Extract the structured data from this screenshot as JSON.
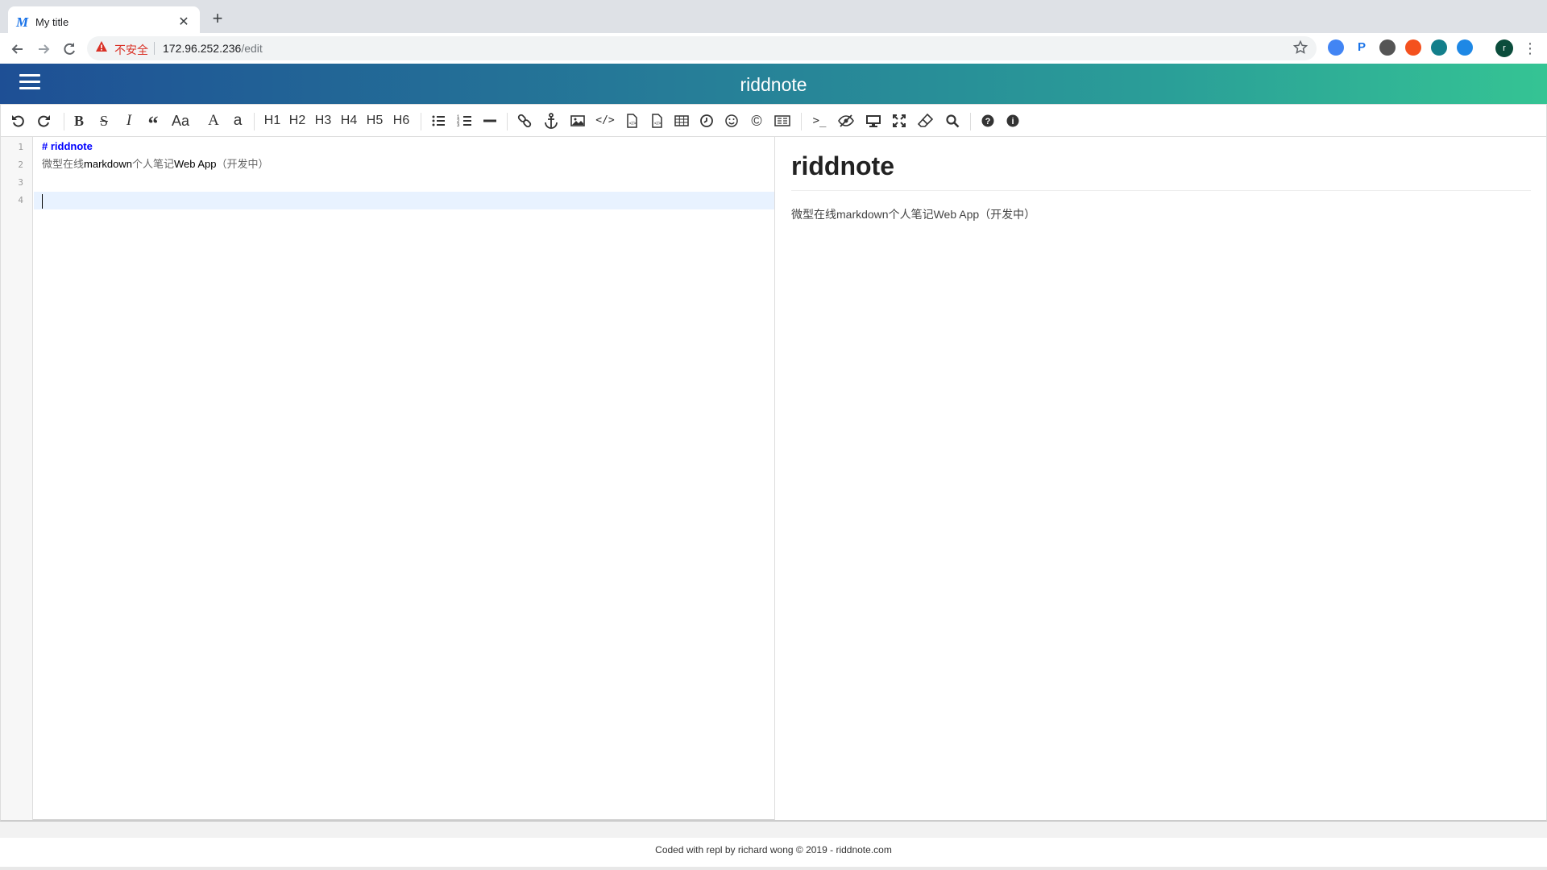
{
  "browser": {
    "tab_title": "My title",
    "tab_favicon": "M",
    "new_tab_symbol": "+",
    "close_symbol": "✕",
    "security_label": "不安全",
    "url_host": "172.96.252.236",
    "url_path": "/edit",
    "profile_initial": "r",
    "extensions": [
      {
        "name": "chrome-ext-icon",
        "glyph": "",
        "color": "#4285f4"
      },
      {
        "name": "p-ext-icon",
        "glyph": "P",
        "color": "#1a73e8"
      },
      {
        "name": "feather-ext-icon",
        "glyph": "",
        "color": "#555555"
      },
      {
        "name": "orange-ext-icon",
        "glyph": "",
        "color": "#f4511e"
      },
      {
        "name": "book-ext-icon",
        "glyph": "",
        "color": "#137f8b"
      },
      {
        "name": "bird-ext-icon",
        "glyph": "",
        "color": "#1e88e5"
      }
    ]
  },
  "app": {
    "title": "riddnote",
    "gradient": [
      "#1e4f95",
      "#35c494"
    ]
  },
  "editor_toolbar": {
    "headings": [
      "H1",
      "H2",
      "H3",
      "H4",
      "H5",
      "H6"
    ],
    "case_upper": "Aa",
    "case_big_a": "A",
    "case_small_a": "a"
  },
  "editor": {
    "line_numbers": [
      "1",
      "2",
      "3",
      "4"
    ],
    "line1": "# riddnote",
    "line2_parts": [
      "微型在线",
      "markdown",
      "个人笔记",
      "Web App",
      "（开发中）"
    ]
  },
  "preview": {
    "heading": "riddnote",
    "paragraph": "微型在线markdown个人笔记Web App（开发中）"
  },
  "footer": {
    "text": "Coded with repl by richard wong © 2019 - riddnote.com"
  }
}
